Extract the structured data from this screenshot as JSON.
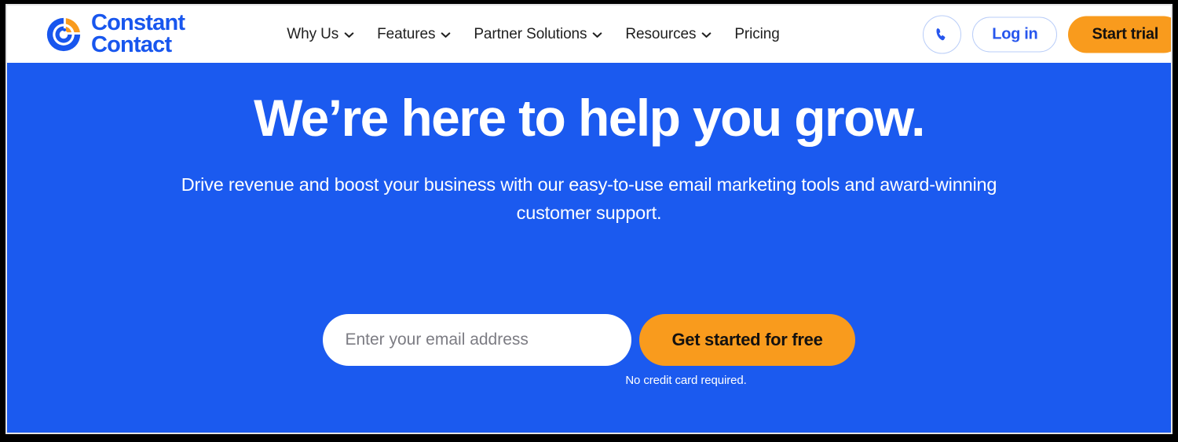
{
  "brand": {
    "name_line1": "Constant",
    "name_line2": "Contact",
    "logo_icon": "constant-contact-logo-icon",
    "blue": "#1856EE",
    "orange": "#F99B1D",
    "hero_blue": "#1B5AEF"
  },
  "header": {
    "nav": [
      {
        "label": "Why Us",
        "has_dropdown": true,
        "icon": "chevron-down-icon"
      },
      {
        "label": "Features",
        "has_dropdown": true,
        "icon": "chevron-down-icon"
      },
      {
        "label": "Partner Solutions",
        "has_dropdown": true,
        "icon": "chevron-down-icon"
      },
      {
        "label": "Resources",
        "has_dropdown": true,
        "icon": "chevron-down-icon"
      },
      {
        "label": "Pricing",
        "has_dropdown": false,
        "icon": ""
      }
    ],
    "phone_icon": "phone-icon",
    "login_label": "Log in",
    "trial_label": "Start trial"
  },
  "hero": {
    "title": "We’re here to help you grow.",
    "subtitle": "Drive revenue and boost your business with our easy-to-use email marketing tools and award-winning customer support.",
    "email_placeholder": "Enter your email address",
    "email_value": "",
    "cta_label": "Get started for free",
    "disclaimer": "No credit card required."
  }
}
